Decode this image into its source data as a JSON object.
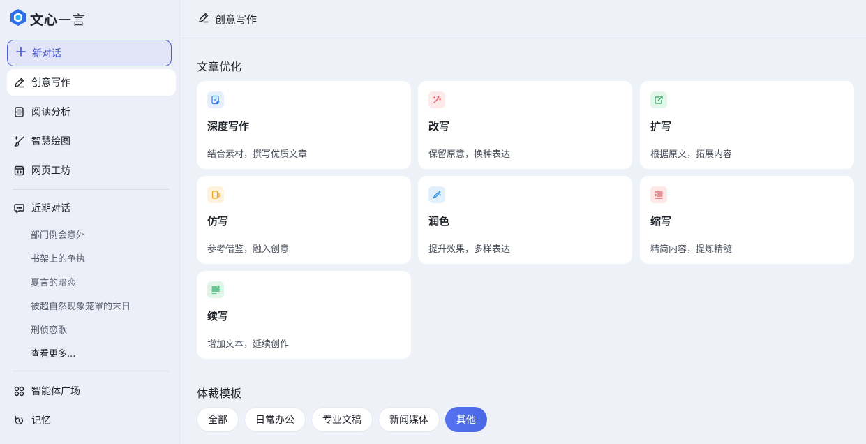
{
  "app": {
    "logo_text_bold": "文心",
    "logo_text_light": "一言",
    "brand_color": "#2f6fe8"
  },
  "sidebar": {
    "new_chat_label": "新对话",
    "nav_items": [
      {
        "label": "创意写作",
        "icon": "pen-icon",
        "active": true
      },
      {
        "label": "阅读分析",
        "icon": "document-icon"
      },
      {
        "label": "智慧绘图",
        "icon": "brush-icon"
      },
      {
        "label": "网页工坊",
        "icon": "code-window-icon"
      }
    ],
    "recent_header": "近期对话",
    "recent_items": [
      "部门例会意外",
      "书架上的争执",
      "夏言的暗恋",
      "被超自然现象笼罩的末日",
      "刑侦恋歌"
    ],
    "more_label": "查看更多...",
    "bottom_items": [
      {
        "label": "智能体广场",
        "icon": "grid-icon"
      },
      {
        "label": "记忆",
        "icon": "memory-icon"
      }
    ]
  },
  "topbar": {
    "title": "创意写作"
  },
  "article_section": {
    "title": "文章优化",
    "cards": [
      {
        "title": "深度写作",
        "desc": "结合素材，撰写优质文章",
        "icon": "edit-doc-icon",
        "color": "#3b7cf0",
        "bg": "#e6f0fd"
      },
      {
        "title": "改写",
        "desc": "保留原意，换种表达",
        "icon": "magic-wand-icon",
        "color": "#e9545b",
        "bg": "#fde9ea"
      },
      {
        "title": "扩写",
        "desc": "根据原文，拓展内容",
        "icon": "expand-icon",
        "color": "#27a65a",
        "bg": "#e3f6ea"
      },
      {
        "title": "仿写",
        "desc": "参考借鉴，融入创意",
        "icon": "copy-icon",
        "color": "#f0a81c",
        "bg": "#fdf3dd"
      },
      {
        "title": "润色",
        "desc": "提升效果，多样表达",
        "icon": "sparkle-pen-icon",
        "color": "#2f8fe6",
        "bg": "#e2f0fc"
      },
      {
        "title": "缩写",
        "desc": "精简内容，提炼精髓",
        "icon": "shrink-lines-icon",
        "color": "#e45c5c",
        "bg": "#fde7e7"
      },
      {
        "title": "续写",
        "desc": "增加文本，延续创作",
        "icon": "continue-lines-icon",
        "color": "#25a65a",
        "bg": "#e1f5e8"
      }
    ]
  },
  "template_section": {
    "title": "体裁模板",
    "chips": [
      {
        "label": "全部"
      },
      {
        "label": "日常办公"
      },
      {
        "label": "专业文稿"
      },
      {
        "label": "新闻媒体"
      },
      {
        "label": "其他",
        "active": true
      }
    ]
  }
}
